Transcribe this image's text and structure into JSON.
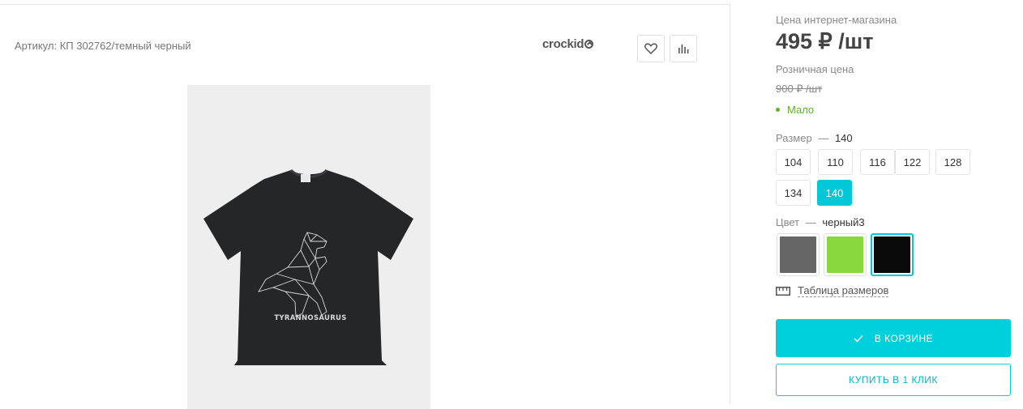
{
  "product": {
    "article": "Артикул: КП 302762/темный черный",
    "brand": "crockid",
    "image_print_text": "TYRANNOSAURUS"
  },
  "actions": {
    "favorite_icon": "heart-icon",
    "compare_icon": "bar-chart-icon"
  },
  "pricing": {
    "online_label": "Цена интернет-магазина",
    "online_price": "495 ₽ /шт",
    "retail_label": "Розничная цена",
    "retail_price": "900 ₽ /шт",
    "stock_status": "Мало",
    "stock_color": "#5fb324"
  },
  "size": {
    "label": "Размер",
    "dash": "—",
    "selected": "140",
    "options": [
      "104",
      "110",
      "116",
      "122",
      "128",
      "134",
      "140"
    ]
  },
  "color": {
    "label": "Цвет",
    "dash": "—",
    "selected": "черный3",
    "swatches": [
      {
        "hex": "#666666"
      },
      {
        "hex": "#88d83e"
      },
      {
        "hex": "#0a0a0a"
      }
    ]
  },
  "size_table": {
    "label": "Таблица размеров",
    "icon": "ruler-icon"
  },
  "buttons": {
    "in_cart": "В КОРЗИНЕ",
    "one_click": "КУПИТЬ В 1 КЛИК"
  },
  "colors": {
    "accent": "#00cfdc"
  }
}
